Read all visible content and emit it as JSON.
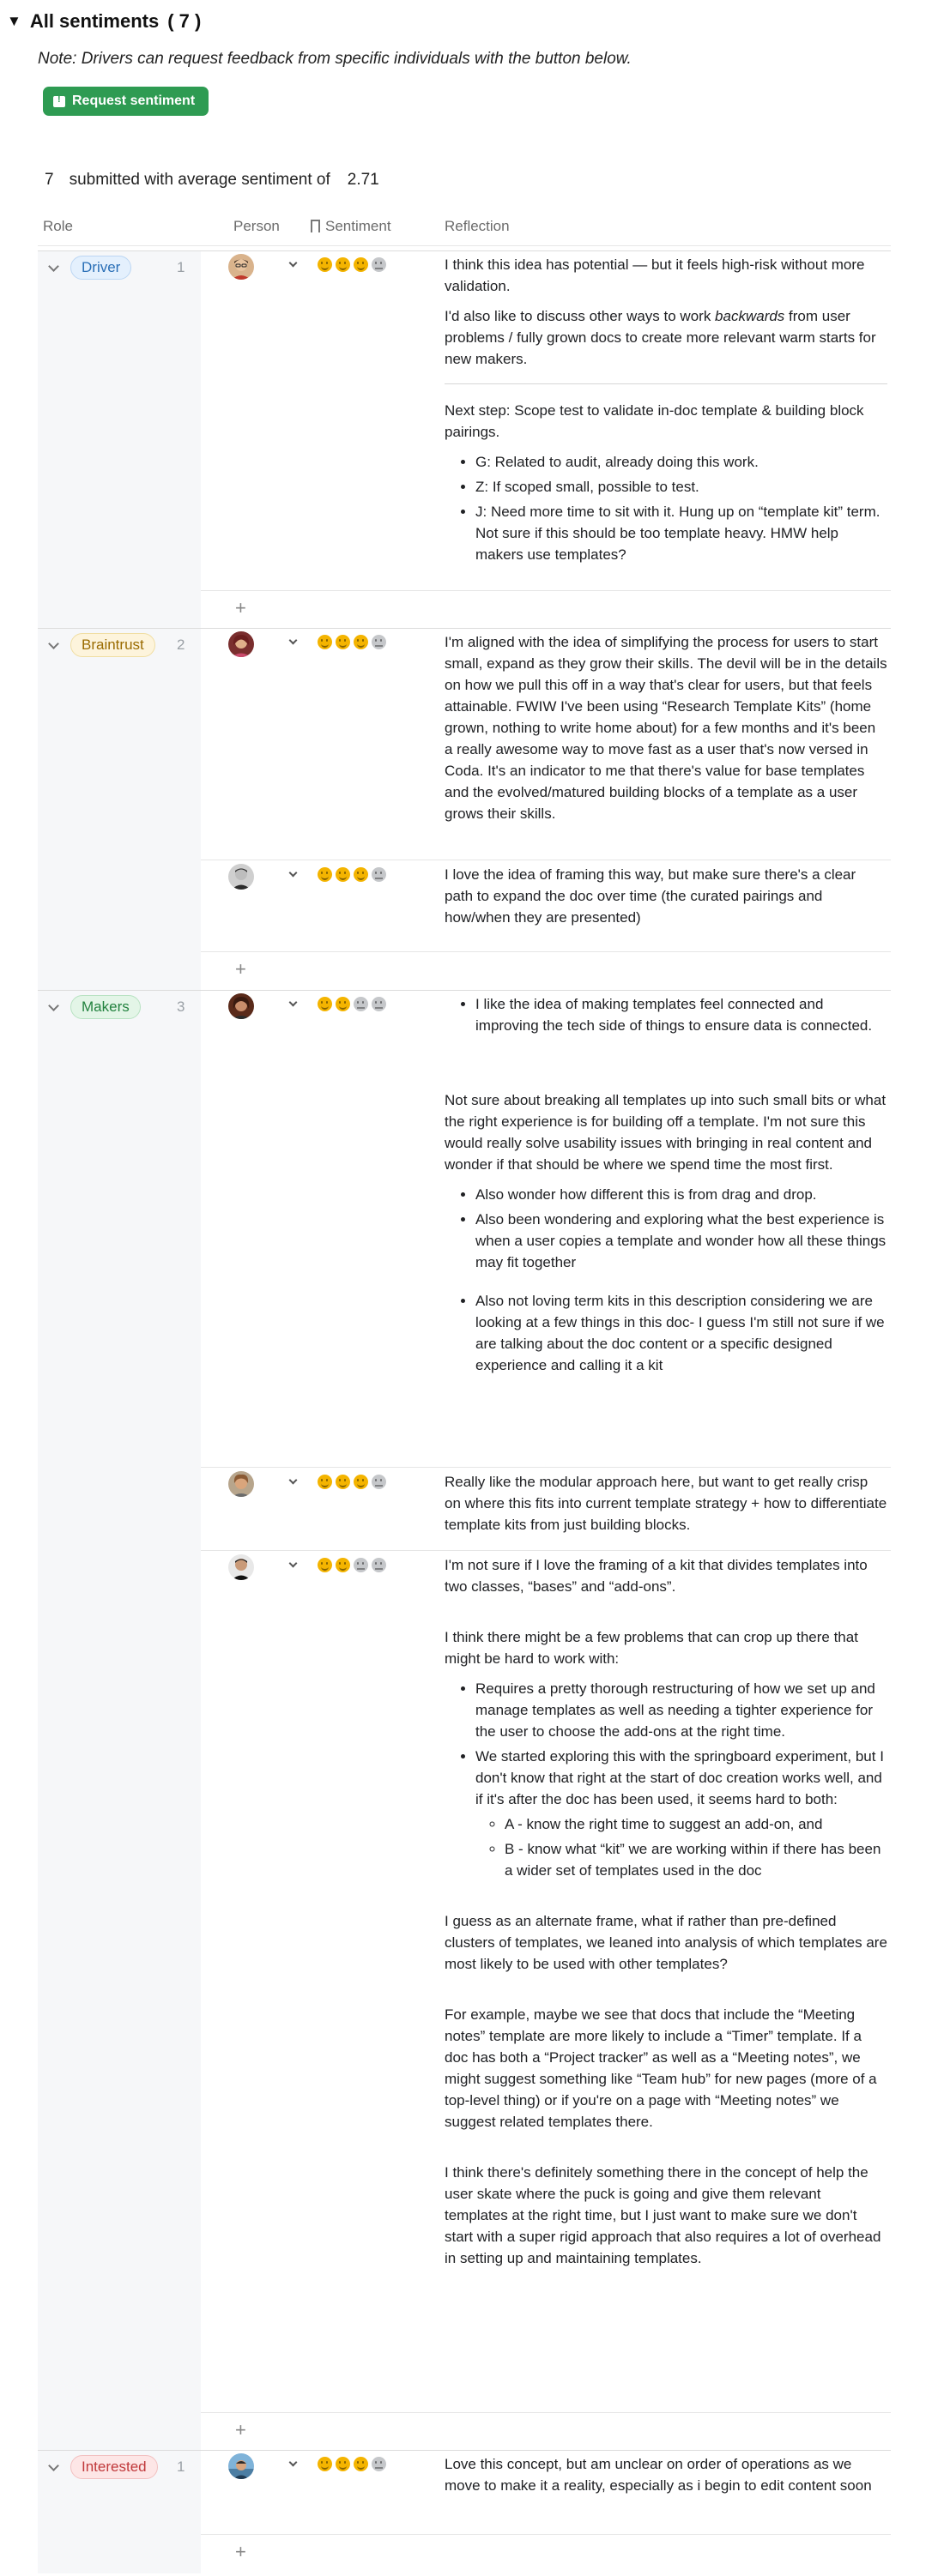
{
  "header": {
    "title": "All sentiments",
    "count": "( 7 )"
  },
  "note": "Note: Drivers can request feedback from specific individuals with the button below.",
  "request_button": "Request sentiment",
  "summary": {
    "count": "7",
    "label": "submitted with average sentiment of",
    "average": "2.71"
  },
  "columns": {
    "role": "Role",
    "person": "Person",
    "sentiment": "Sentiment",
    "reflection": "Reflection"
  },
  "colors": {
    "accent_green": "#2e9b52",
    "sentiment_on": "#f4b400",
    "sentiment_off": "#c5c7ca"
  },
  "groups": [
    {
      "role": "Driver",
      "count": "1",
      "entries": [
        {
          "sentiment": 3,
          "reflection": {
            "p1": "I think this idea has potential — but it feels high-risk without more validation.",
            "p2a": "I'd also like to discuss other ways to work ",
            "p2b": "backwards",
            "p2c": " from user problems / fully grown docs to create more relevant warm starts for new makers.",
            "p3": "Next step: Scope test to validate in-doc template & building block pairings.",
            "bullets": [
              "G: Related to audit, already doing this work.",
              "Z: If scoped small, possible to test.",
              "J: Need more time to sit with it. Hung up on “template kit” term. Not sure if this should be too template heavy. HMW help makers use templates?"
            ]
          }
        }
      ]
    },
    {
      "role": "Braintrust",
      "count": "2",
      "entries": [
        {
          "sentiment": 3,
          "reflection": {
            "p1": "I'm aligned with the idea of simplifying the process for users to start small, expand as they grow their skills. The devil will be in the details on how we pull this off in a way that's clear for users, but that feels attainable. FWIW I've been using “Research Template Kits” (home grown, nothing to write home about) for a few months and it's been a really awesome way to move fast as a user that's now versed in Coda. It's an indicator to me that there's value for base templates and the evolved/matured building blocks of a template as a user grows their skills."
          }
        },
        {
          "sentiment": 3,
          "reflection": {
            "p1": "I love the idea of framing this way, but make sure there's a clear path to expand the doc over time (the curated pairings and how/when they are presented)"
          }
        }
      ]
    },
    {
      "role": "Makers",
      "count": "3",
      "entries": [
        {
          "sentiment": 2,
          "reflection": {
            "b1": "I like the idea of making templates feel connected and improving the tech side of things to ensure data is connected.",
            "p1": "Not sure about breaking all templates up into such small bits or what the right experience is for building off a template. I'm not sure this would really solve usability issues with bringing in real content and wonder if that should be where we spend time the most first.",
            "b2": "Also wonder how different this is from drag and drop.",
            "b3": "Also been wondering and exploring what the best experience is when a user copies a template and wonder how all these things may fit together",
            "b4": "Also not loving term kits in this description considering we are looking at a few things in this doc- I guess I'm still not sure if we are talking about the doc content or a specific designed experience and calling it a kit"
          }
        },
        {
          "sentiment": 3,
          "reflection": {
            "p1": "Really like the modular approach here, but want to get really crisp on where this fits into current template strategy + how to differentiate template kits from just building blocks."
          }
        },
        {
          "sentiment": 2,
          "reflection": {
            "p1": "I'm not sure if I love the framing of a kit that divides templates into two classes, “bases” and “add-ons”.",
            "p2": "I think there might be a few problems that can crop up there that might be hard to work with:",
            "b1": "Requires a pretty thorough restructuring of how we set up and manage templates as well as needing a tighter experience for the user to choose the add-ons at the right time.",
            "b2": "We started exploring this with the springboard experiment, but I don't know that right at the start of doc creation works well, and if it's after the doc has been used, it seems hard to both:",
            "s1": "A - know the right time to suggest an add-on, and",
            "s2": "B - know what “kit” we are working within if there has been a wider set of templates used in the doc",
            "p3": "I guess as an alternate frame, what if rather than pre-defined clusters of templates, we leaned into analysis of which templates are most likely to be used with other templates?",
            "p4": "For example, maybe we see that docs that include the “Meeting notes” template are more likely to include a “Timer” template. If a doc has both a “Project tracker” as well as a “Meeting notes”, we might suggest something like “Team hub” for new pages (more of a top-level thing) or if you're on a page with “Meeting notes” we suggest related templates there.",
            "p5": "I think there's definitely something there in the concept of help the user skate where the puck is going and give them relevant templates at the right time, but I just want to make sure we don't start with a super rigid approach that also requires a lot of overhead in setting up and maintaining templates."
          }
        }
      ]
    },
    {
      "role": "Interested",
      "count": "1",
      "entries": [
        {
          "sentiment": 3,
          "reflection": {
            "p1": "Love this concept, but am unclear on order of operations as we move to make it a reality, especially as i begin to edit content soon"
          }
        }
      ]
    }
  ]
}
